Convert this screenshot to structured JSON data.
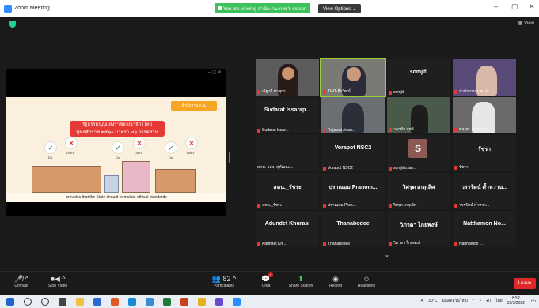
{
  "window": {
    "title": "Zoom Meeting",
    "share_banner": "You are viewing สำนักงาน ก.พ.'s screen",
    "view_options": "View Options ⌄",
    "minimize": "–",
    "maximize": "▢",
    "close": "✕"
  },
  "meeting": {
    "view_label": "View"
  },
  "share": {
    "window_controls": "–  ▢  ✕",
    "logo_text": "สำนักงาน ก.พ.",
    "headline_1": "รัฐธรรมนูญแห่งราชอาณาจักรไทย",
    "headline_2": "พุทธศักราช ๒๕๖๐ มาตรา ๗๖ วรรคสาม",
    "do_label": "Do",
    "dont_label": "Don't",
    "caption": "provides that the State should formulate ethical standards"
  },
  "gallery": {
    "tiles": [
      {
        "big": "",
        "name": "ณัฐวดี ทาสุกร..."
      },
      {
        "big": "",
        "name": "TINT-จีรวัฒน์"
      },
      {
        "big": "somjitl",
        "name": "somjitl"
      },
      {
        "big": "",
        "name": "สำนักงาน ก.พ. (ก..."
      },
      {
        "big": "Sudarat Issarap...",
        "name": "Sudarat Issar..."
      },
      {
        "big": "",
        "name": "Rejawat Anan..."
      },
      {
        "big": "",
        "name": "วลฤทัย สุทธิ..."
      },
      {
        "big": "",
        "name": "ชล.สร. อรวรรณ..."
      },
      {
        "big": "",
        "name": "สคพ. อสจ. ศุภัฒนะ..."
      },
      {
        "big": "Vorapot NSC2",
        "name": "Vorapot NSC2"
      },
      {
        "big": "",
        "name": "somjitsr.tan..."
      },
      {
        "big": "รัชรา",
        "name": "รัชรา"
      },
      {
        "big": "ลหน._รัชระ",
        "name": "ลหน._รัชระ"
      },
      {
        "big": "ปราณอม Pranom...",
        "name": "ปราณอม Pran..."
      },
      {
        "big": "วิศรุต เกตุเลิศ",
        "name": "วิศรุต เกตุเลิศ"
      },
      {
        "big": "วรรรัตน์ ค้ำหวาน...",
        "name": "วรรรัตน์ ค้ำหวา..."
      },
      {
        "big": "Adundet Khurasi",
        "name": "Adundet Kh..."
      },
      {
        "big": "Thanabodee",
        "name": "Thanabodee"
      },
      {
        "big": "วิภาดา ไกยพงษ์",
        "name": "วิภาดา ไกยพงษ์"
      },
      {
        "big": "Natthamon No...",
        "name": "Natthamon ..."
      }
    ],
    "s_initial": "S"
  },
  "toolbar": {
    "unmute": "Unmute",
    "stop_video": "Stop Video",
    "participants": "Participants",
    "participants_count": "82",
    "chat": "Chat",
    "chat_badge": "1",
    "share_screen": "Share Screen",
    "record": "Record",
    "reactions": "Reactions",
    "leave": "Leave"
  },
  "taskbar": {
    "temperature": "30°C",
    "weather": "มีแดดส่วนใหญ่",
    "lang": "ไทย",
    "time": "8:52",
    "date": "31/3/2022"
  },
  "colors": {
    "accent_green": "#3dc15b",
    "leave_red": "#e02828",
    "zoom_blue": "#2d8cff"
  }
}
